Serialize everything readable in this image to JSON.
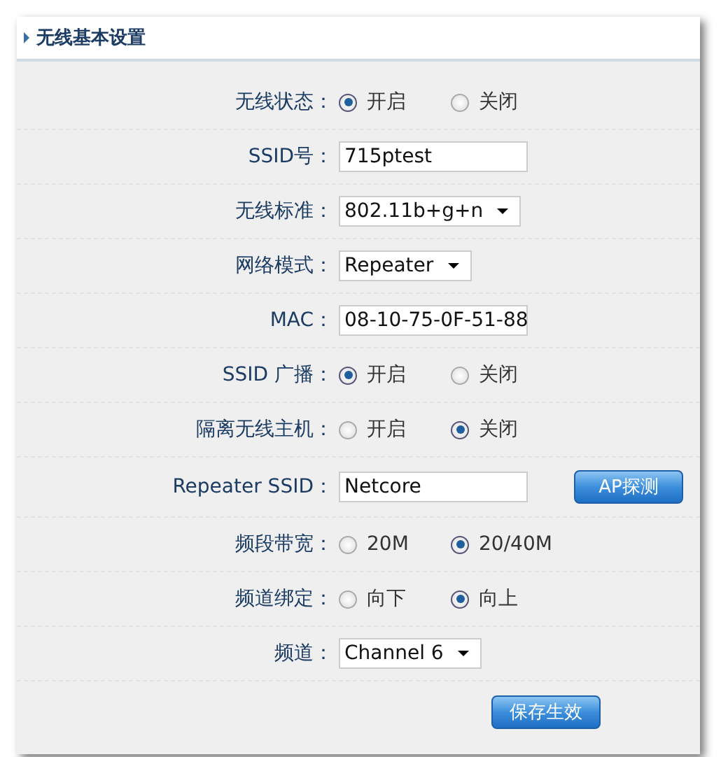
{
  "section": {
    "title": "无线基本设置"
  },
  "rows": [
    {
      "kind": "radio",
      "label": "无线状态：",
      "options": [
        {
          "label": "开启",
          "selected": true
        },
        {
          "label": "关闭",
          "selected": false
        }
      ]
    },
    {
      "kind": "text",
      "label": "SSID号：",
      "value": "715ptest"
    },
    {
      "kind": "select",
      "label": "无线标准：",
      "value": "802.11b+g+n"
    },
    {
      "kind": "select",
      "label": "网络模式：",
      "value": "Repeater"
    },
    {
      "kind": "text",
      "label": "MAC：",
      "value": "08-10-75-0F-51-88"
    },
    {
      "kind": "radio",
      "label": "SSID 广播：",
      "options": [
        {
          "label": "开启",
          "selected": true
        },
        {
          "label": "关闭",
          "selected": false
        }
      ]
    },
    {
      "kind": "radio",
      "label": "隔离无线主机：",
      "options": [
        {
          "label": "开启",
          "selected": false
        },
        {
          "label": "关闭",
          "selected": true
        }
      ]
    },
    {
      "kind": "text",
      "label": "Repeater SSID：",
      "value": "Netcore",
      "button": "AP探测"
    },
    {
      "kind": "radio",
      "label": "频段带宽：",
      "options": [
        {
          "label": "20M",
          "selected": false
        },
        {
          "label": "20/40M",
          "selected": true
        }
      ]
    },
    {
      "kind": "radio",
      "label": "频道绑定：",
      "options": [
        {
          "label": "向下",
          "selected": false
        },
        {
          "label": "向上",
          "selected": true
        }
      ]
    },
    {
      "kind": "select",
      "label": "频道：",
      "value": "Channel 6"
    }
  ],
  "save_button": "保存生效"
}
